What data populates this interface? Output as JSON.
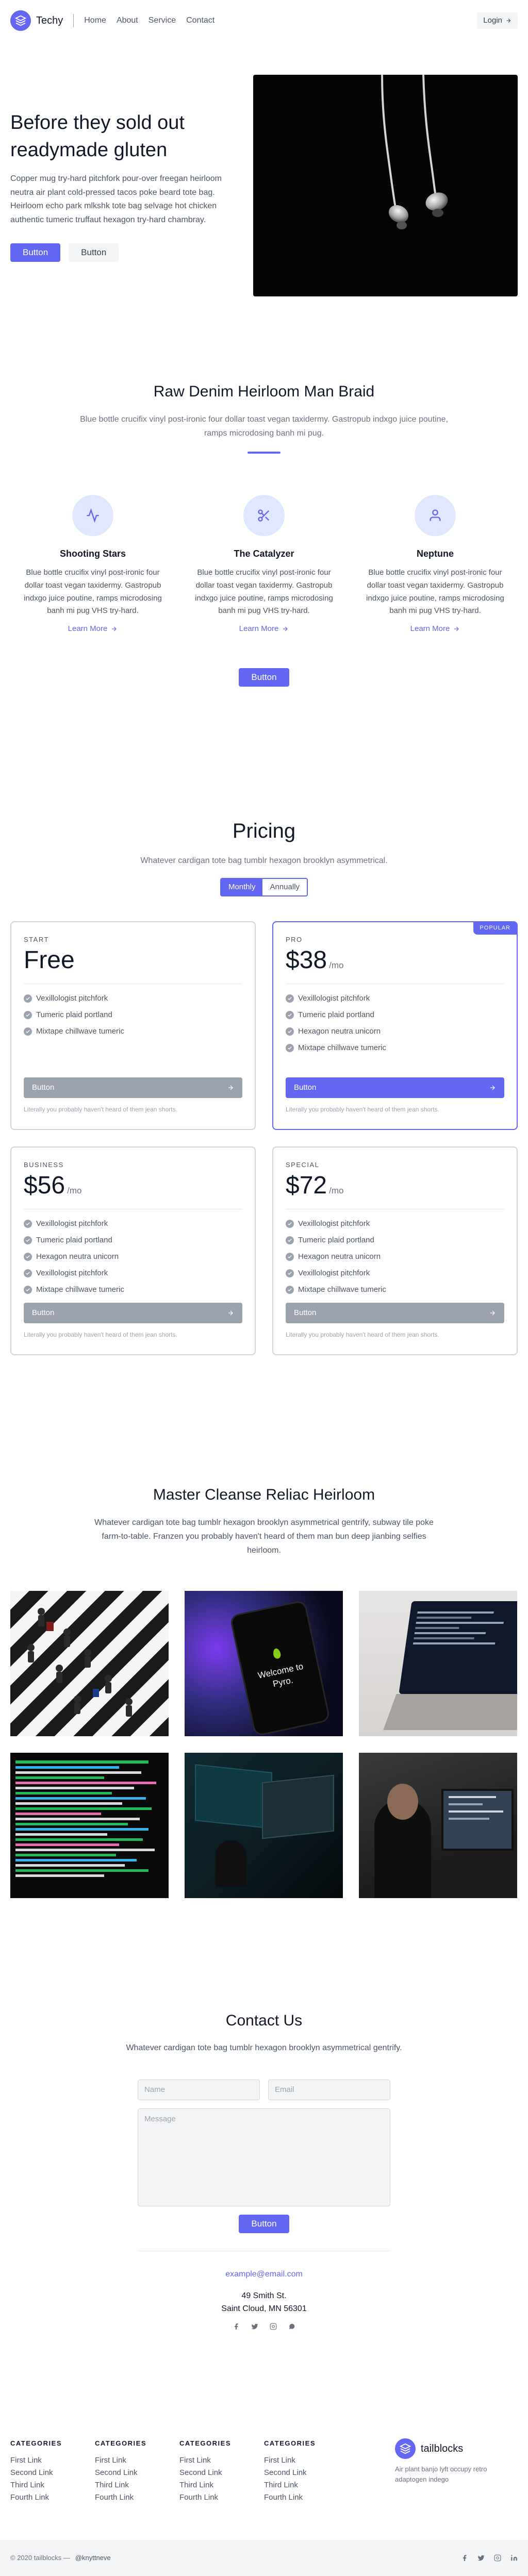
{
  "header": {
    "brand": "Techy",
    "nav": [
      "Home",
      "About",
      "Service",
      "Contact"
    ],
    "login": "Login"
  },
  "hero": {
    "title": "Before they sold out readymade gluten",
    "text": "Copper mug try-hard pitchfork pour-over freegan heirloom neutra air plant cold-pressed tacos poke beard tote bag. Heirloom echo park mlkshk tote bag selvage hot chicken authentic tumeric truffaut hexagon try-hard chambray.",
    "primary": "Button",
    "secondary": "Button"
  },
  "features": {
    "title": "Raw Denim Heirloom Man Braid",
    "subtitle": "Blue bottle crucifix vinyl post-ironic four dollar toast vegan taxidermy. Gastropub indxgo juice poutine, ramps microdosing banh mi pug.",
    "items": [
      {
        "icon": "pulse-icon",
        "title": "Shooting Stars",
        "text": "Blue bottle crucifix vinyl post-ironic four dollar toast vegan taxidermy. Gastropub indxgo juice poutine, ramps microdosing banh mi pug VHS try-hard.",
        "link": "Learn More"
      },
      {
        "icon": "scissors-icon",
        "title": "The Catalyzer",
        "text": "Blue bottle crucifix vinyl post-ironic four dollar toast vegan taxidermy. Gastropub indxgo juice poutine, ramps microdosing banh mi pug VHS try-hard.",
        "link": "Learn More"
      },
      {
        "icon": "user-icon",
        "title": "Neptune",
        "text": "Blue bottle crucifix vinyl post-ironic four dollar toast vegan taxidermy. Gastropub indxgo juice poutine, ramps microdosing banh mi pug VHS try-hard.",
        "link": "Learn More"
      }
    ],
    "button": "Button"
  },
  "pricing": {
    "title": "Pricing",
    "subtitle": "Whatever cardigan tote bag tumblr hexagon brooklyn asymmetrical.",
    "toggle": {
      "monthly": "Monthly",
      "annually": "Annually"
    },
    "popular": "POPULAR",
    "plans": [
      {
        "tier": "START",
        "price": "Free",
        "per": "",
        "features": [
          "Vexillologist pitchfork",
          "Tumeric plaid portland",
          "Mixtape chillwave tumeric"
        ],
        "button": "Button",
        "note": "Literally you probably haven't heard of them jean shorts."
      },
      {
        "tier": "PRO",
        "price": "$38",
        "per": "/mo",
        "features": [
          "Vexillologist pitchfork",
          "Tumeric plaid portland",
          "Hexagon neutra unicorn",
          "Mixtape chillwave tumeric"
        ],
        "button": "Button",
        "note": "Literally you probably haven't heard of them jean shorts."
      },
      {
        "tier": "BUSINESS",
        "price": "$56",
        "per": "/mo",
        "features": [
          "Vexillologist pitchfork",
          "Tumeric plaid portland",
          "Hexagon neutra unicorn",
          "Vexillologist pitchfork",
          "Mixtape chillwave tumeric"
        ],
        "button": "Button",
        "note": "Literally you probably haven't heard of them jean shorts."
      },
      {
        "tier": "SPECIAL",
        "price": "$72",
        "per": "/mo",
        "features": [
          "Vexillologist pitchfork",
          "Tumeric plaid portland",
          "Hexagon neutra unicorn",
          "Vexillologist pitchfork",
          "Mixtape chillwave tumeric"
        ],
        "button": "Button",
        "note": "Literally you probably haven't heard of them jean shorts."
      }
    ]
  },
  "gallery": {
    "title": "Master Cleanse Reliac Heirloom",
    "subtitle": "Whatever cardigan tote bag tumblr hexagon brooklyn asymmetrical gentrify, subway tile poke farm-to-table. Franzen you probably haven't heard of them man bun deep jianbing selfies heirloom.",
    "phone_text": "Welcome to Pyro."
  },
  "contact": {
    "title": "Contact Us",
    "subtitle": "Whatever cardigan tote bag tumblr hexagon brooklyn asymmetrical gentrify.",
    "name_placeholder": "Name",
    "email_placeholder": "Email",
    "message_placeholder": "Message",
    "button": "Button",
    "email": "example@email.com",
    "address_line1": "49 Smith St.",
    "address_line2": "Saint Cloud, MN 56301"
  },
  "footer": {
    "columns": [
      {
        "heading": "CATEGORIES",
        "links": [
          "First Link",
          "Second Link",
          "Third Link",
          "Fourth Link"
        ]
      },
      {
        "heading": "CATEGORIES",
        "links": [
          "First Link",
          "Second Link",
          "Third Link",
          "Fourth Link"
        ]
      },
      {
        "heading": "CATEGORIES",
        "links": [
          "First Link",
          "Second Link",
          "Third Link",
          "Fourth Link"
        ]
      },
      {
        "heading": "CATEGORIES",
        "links": [
          "First Link",
          "Second Link",
          "Third Link",
          "Fourth Link"
        ]
      }
    ],
    "brand": "tailblocks",
    "description": "Air plant banjo lyft occupy retro adaptogen indego",
    "copyright": "© 2020 tailblocks —",
    "handle": "@knyttneve"
  },
  "colors": {
    "accent": "#6366f1",
    "muted": "#9ca3af"
  }
}
